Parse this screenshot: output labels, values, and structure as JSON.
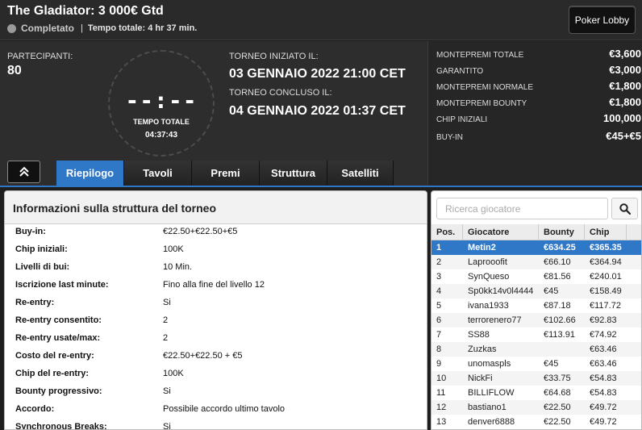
{
  "header": {
    "title": "The Gladiator: 3 000€ Gtd",
    "status": "Completato",
    "separator": "|",
    "total_time": "Tempo totale: 4 hr 37 min.",
    "lobby_button": "Poker Lobby"
  },
  "info": {
    "participants_label": "PARTECIPANTI:",
    "participants_value": "80",
    "clock_digits": "--:--",
    "clock_label": "TEMPO TOTALE",
    "clock_time": "04:37:43",
    "start_label": "TORNEO INIZIATO IL:",
    "start_value": "03 GENNAIO 2022  21:00 CET",
    "end_label": "TORNEO CONCLUSO IL:",
    "end_value": "04 GENNAIO 2022  01:37 CET"
  },
  "prize": [
    {
      "label": "MONTEPREMI TOTALE",
      "value": "€3,600"
    },
    {
      "label": "GARANTITO",
      "value": "€3,000"
    },
    {
      "label": "MONTEPREMI NORMALE",
      "value": "€1,800"
    },
    {
      "label": "MONTEPREMI BOUNTY",
      "value": "€1,800"
    },
    {
      "label": "CHIP INIZIALI",
      "value": "100,000"
    },
    {
      "label": "BUY-IN",
      "value": "€45+€5"
    }
  ],
  "tabs": [
    "Riepilogo",
    "Tavoli",
    "Premi",
    "Struttura",
    "Satelliti"
  ],
  "structure": {
    "title": "Informazioni sulla struttura del torneo",
    "rows": [
      {
        "label": "Buy-in:",
        "value": "€22.50+€22.50+€5"
      },
      {
        "label": "Chip iniziali:",
        "value": "100K"
      },
      {
        "label": "Livelli di bui:",
        "value": "10 Min."
      },
      {
        "label": "Iscrizione last minute:",
        "value": "Fino alla fine del livello 12"
      },
      {
        "label": "Re-entry:",
        "value": "Si"
      },
      {
        "label": "Re-entry consentito:",
        "value": "2"
      },
      {
        "label": "Re-entry usate/max:",
        "value": "2"
      },
      {
        "label": "Costo del re-entry:",
        "value": "€22.50+€22.50 + €5"
      },
      {
        "label": "Chip del re-entry:",
        "value": "100K"
      },
      {
        "label": "Bounty progressivo:",
        "value": "Si"
      },
      {
        "label": "Accordo:",
        "value": "Possibile accordo ultimo tavolo"
      },
      {
        "label": "Synchronous Breaks:",
        "value": "Si"
      }
    ]
  },
  "players": {
    "search_placeholder": "Ricerca giocatore",
    "columns": [
      "Pos.",
      "Giocatore",
      "Bounty",
      "Chip"
    ],
    "rows": [
      {
        "pos": "1",
        "name": "Metin2",
        "bounty": "€634.25",
        "chip": "€365.35"
      },
      {
        "pos": "2",
        "name": "Laprooofit",
        "bounty": "€66.10",
        "chip": "€364.94"
      },
      {
        "pos": "3",
        "name": "SynQueso",
        "bounty": "€81.56",
        "chip": "€240.01"
      },
      {
        "pos": "4",
        "name": "Sp0kk14v0l4444",
        "bounty": "€45",
        "chip": "€158.49"
      },
      {
        "pos": "5",
        "name": "ivana1933",
        "bounty": "€87.18",
        "chip": "€117.72"
      },
      {
        "pos": "6",
        "name": "terrorenero77",
        "bounty": "€102.66",
        "chip": "€92.83"
      },
      {
        "pos": "7",
        "name": "SS88",
        "bounty": "€113.91",
        "chip": "€74.92"
      },
      {
        "pos": "8",
        "name": "Zuzkas",
        "bounty": "",
        "chip": "€63.46"
      },
      {
        "pos": "9",
        "name": "unomaspls",
        "bounty": "€45",
        "chip": "€63.46"
      },
      {
        "pos": "10",
        "name": "NickFi",
        "bounty": "€33.75",
        "chip": "€54.83"
      },
      {
        "pos": "11",
        "name": "BILLIFLOW",
        "bounty": "€64.68",
        "chip": "€54.83"
      },
      {
        "pos": "12",
        "name": "bastiano1",
        "bounty": "€22.50",
        "chip": "€49.72"
      },
      {
        "pos": "13",
        "name": "denver6888",
        "bounty": "€22.50",
        "chip": "€49.72"
      }
    ]
  },
  "colors": {
    "accent": "#2f77c7",
    "background": "#1e1e1e"
  }
}
